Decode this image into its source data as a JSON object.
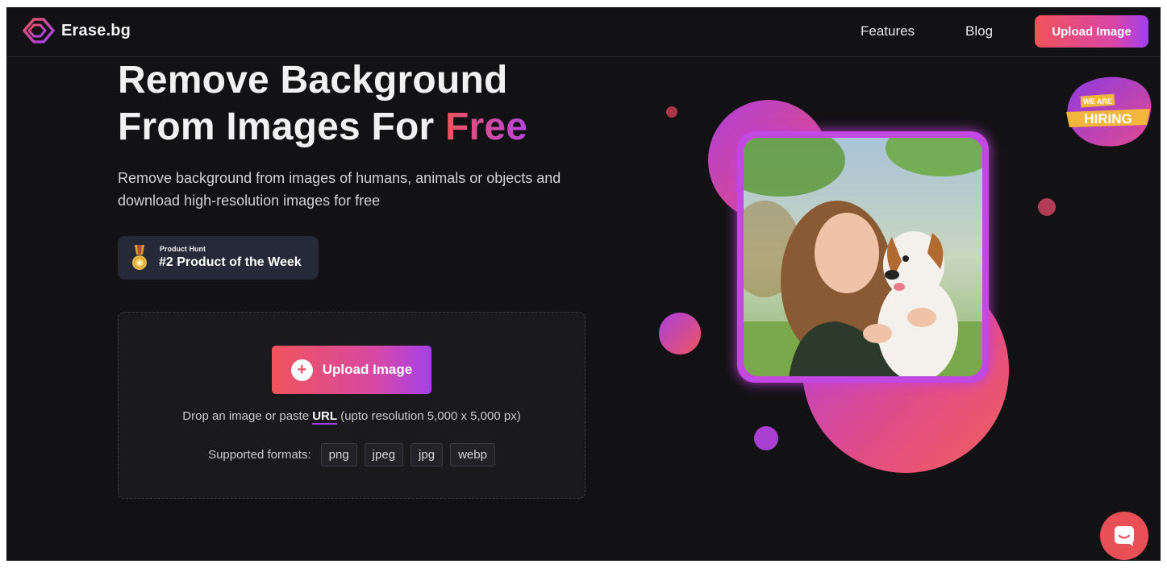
{
  "header": {
    "logo_text": "Erase.bg",
    "nav": {
      "features": "Features",
      "blog": "Blog",
      "upload": "Upload Image"
    }
  },
  "hero": {
    "title_line1": "Remove Background",
    "title_line2_prefix": "From Images For ",
    "title_highlight": "Free",
    "subtitle": "Remove background from images of humans, animals or objects and download high-resolution images for free"
  },
  "badge": {
    "small": "Product Hunt",
    "big": "#2 Product of the Week"
  },
  "upload": {
    "button_label": "Upload Image",
    "drop_prefix": "Drop an image or paste ",
    "drop_link": "URL",
    "drop_suffix": " (upto resolution 5,000 x 5,000 px)",
    "formats_label": "Supported formats:",
    "formats": [
      "png",
      "jpeg",
      "jpg",
      "webp"
    ]
  },
  "hiring": {
    "line1": "WE ARE",
    "line2": "HIRING"
  },
  "colors": {
    "background": "#121214",
    "accent_start": "#f1535b",
    "accent_end": "#a540ec"
  },
  "icons": {
    "logo": "erase-bg-logo-icon",
    "plus": "plus-icon",
    "medal": "medal-icon",
    "chat": "chat-icon"
  }
}
